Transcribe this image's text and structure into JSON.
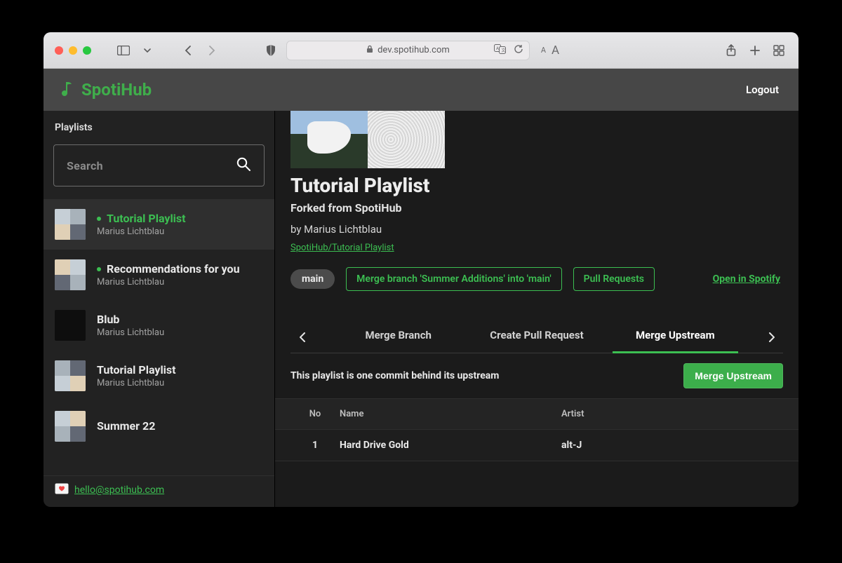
{
  "browser": {
    "url_host": "dev.spotihub.com"
  },
  "brand": {
    "name": "SpotiHub"
  },
  "header": {
    "logout": "Logout"
  },
  "sidebar": {
    "title": "Playlists",
    "search_placeholder": "Search",
    "items": [
      {
        "title": "Tutorial Playlist",
        "owner": "Marius Lichtblau",
        "modified": true,
        "active": true
      },
      {
        "title": "Recommendations for you",
        "owner": "Marius Lichtblau",
        "modified": true,
        "active": false
      },
      {
        "title": "Blub",
        "owner": "Marius Lichtblau",
        "modified": false,
        "active": false
      },
      {
        "title": "Tutorial Playlist",
        "owner": "Marius Lichtblau",
        "modified": false,
        "active": false
      },
      {
        "title": "Summer 22",
        "owner": "",
        "modified": false,
        "active": false
      }
    ],
    "email_label": "hello@spotihub.com"
  },
  "play": {
    "title": "Tutorial Playlist",
    "forked_from": "Forked from SpotiHub",
    "byline": "by Marius Lichtblau",
    "fork_path": "SpotiHub/Tutorial Playlist",
    "branch_pill": "main",
    "merge_box": "Merge branch 'Summer Additions' into 'main'",
    "pr_box": "Pull Requests",
    "open_link": "Open in Spotify"
  },
  "tabs": {
    "items": [
      "Merge Branch",
      "Create Pull Request",
      "Merge Upstream"
    ],
    "active_index": 2
  },
  "behind": {
    "text": "This playlist is one commit behind its upstream",
    "button": "Merge Upstream"
  },
  "table": {
    "headers": {
      "no": "No",
      "name": "Name",
      "artist": "Artist"
    },
    "rows": [
      {
        "no": "1",
        "name": "Hard Drive Gold",
        "artist": "alt-J"
      }
    ]
  }
}
